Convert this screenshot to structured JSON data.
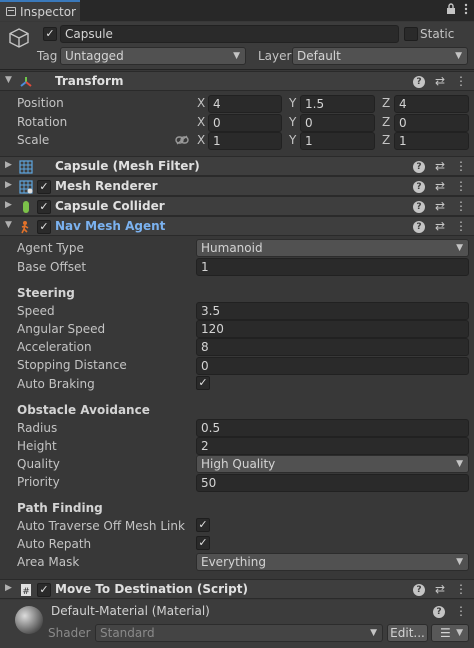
{
  "tab": {
    "title": "Inspector",
    "lock_icon": "lock-icon",
    "menu_icon": "kebab-icon"
  },
  "object": {
    "icon": "cube-icon",
    "active": "✓",
    "name": "Capsule",
    "static_label": "Static",
    "tag_label": "Tag",
    "tag_value": "Untagged",
    "layer_label": "Layer",
    "layer_value": "Default"
  },
  "transform": {
    "title": "Transform",
    "rows": [
      {
        "label": "Position",
        "x": "4",
        "y": "1.5",
        "z": "4"
      },
      {
        "label": "Rotation",
        "x": "0",
        "y": "0",
        "z": "0"
      },
      {
        "label": "Scale",
        "x": "1",
        "y": "1",
        "z": "1"
      }
    ],
    "axes": {
      "x": "X",
      "y": "Y",
      "z": "Z"
    }
  },
  "components": {
    "mesh_filter": "Capsule (Mesh Filter)",
    "mesh_renderer": "Mesh Renderer",
    "capsule_collider": "Capsule Collider",
    "nav_mesh_agent": "Nav Mesh Agent",
    "move_script": "Move To Destination (Script)"
  },
  "agent": {
    "agent_type_label": "Agent Type",
    "agent_type_value": "Humanoid",
    "base_offset_label": "Base Offset",
    "base_offset_value": "1",
    "steering_header": "Steering",
    "speed_label": "Speed",
    "speed_value": "3.5",
    "angular_speed_label": "Angular Speed",
    "angular_speed_value": "120",
    "acceleration_label": "Acceleration",
    "acceleration_value": "8",
    "stopping_distance_label": "Stopping Distance",
    "stopping_distance_value": "0",
    "auto_braking_label": "Auto Braking",
    "obstacle_header": "Obstacle Avoidance",
    "radius_label": "Radius",
    "radius_value": "0.5",
    "height_label": "Height",
    "height_value": "2",
    "quality_label": "Quality",
    "quality_value": "High Quality",
    "priority_label": "Priority",
    "priority_value": "50",
    "pathfinding_header": "Path Finding",
    "auto_traverse_label": "Auto Traverse Off Mesh Link",
    "auto_repath_label": "Auto Repath",
    "area_mask_label": "Area Mask",
    "area_mask_value": "Everything",
    "check": "✓"
  },
  "material": {
    "name": "Default-Material (Material)",
    "shader_label": "Shader",
    "shader_value": "Standard",
    "edit_button": "Edit...",
    "list_icon": "list-icon"
  },
  "colors": {
    "accent": "#3a79bb",
    "selected_component": "#7bb2f0",
    "background": "#383838"
  }
}
